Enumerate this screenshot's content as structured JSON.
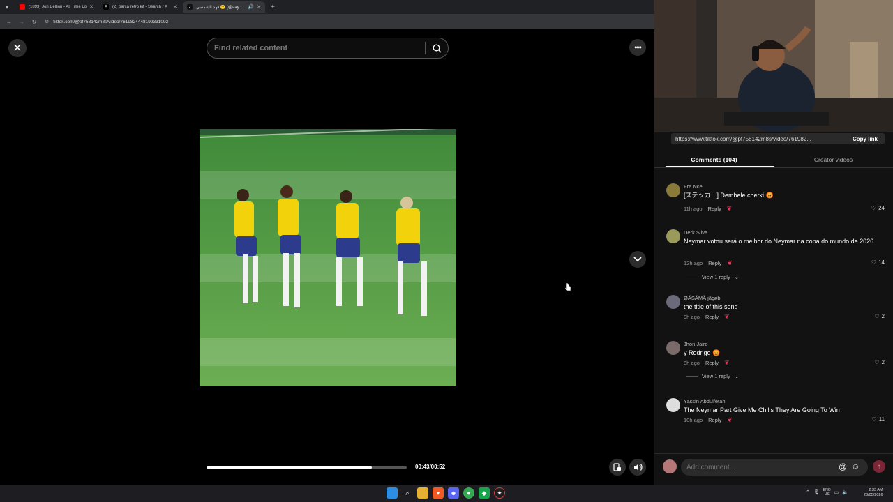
{
  "browser": {
    "tabs": [
      {
        "label": "(1893) Jon Bellion - All Time Lo",
        "favicon_color": "#ff0000",
        "active": false
      },
      {
        "label": "(2) barca retro kit - Search / X",
        "favicon_color": "#000000",
        "active": false
      },
      {
        "label": "فهد الشمسي 🙂 (@aaywasa)",
        "favicon_color": "#111111",
        "active": true
      }
    ],
    "url": "tiktok.com/@pf758142m8s/video/7619824448199331092"
  },
  "player": {
    "search_placeholder": "Find related content",
    "time": "00:43/00:52",
    "progress": 0.827
  },
  "side": {
    "share_url": "https://www.tiktok.com/@pf758142m8s/video/761982...",
    "copy_link": "Copy link",
    "tabs": [
      "Comments (104)",
      "Creator videos"
    ],
    "comments": [
      {
        "name": "Fra Nce",
        "text": "[ステッカー] Dembele cherki 😡",
        "age": "11h ago",
        "reply": "Reply",
        "likes": "24",
        "avatar_color": "#8a7a3a",
        "view_replies": ""
      },
      {
        "name": "Derk Silva",
        "text": "Neymar votou será o melhor do Neymar na copa do mundo de 2026",
        "age": "12h ago",
        "reply": "Reply",
        "likes": "14",
        "avatar_color": "#9a9a5a",
        "view_replies": "View 1 reply"
      },
      {
        "name": "ØÃSÃMÃ jãçøb",
        "text": "the title of this song",
        "age": "9h ago",
        "reply": "Reply",
        "likes": "2",
        "avatar_color": "#6a6a7a",
        "view_replies": ""
      },
      {
        "name": "Jhon Jairo",
        "text": "y Rodrigo 😡",
        "age": "8h ago",
        "reply": "Reply",
        "likes": "2",
        "avatar_color": "#7a6a6a",
        "view_replies": "View 1 reply"
      },
      {
        "name": "Yassin Abdulfetah",
        "text": "The Neymar Part Give Me Chills They Are Going To Win",
        "age": "10h ago",
        "reply": "Reply",
        "likes": "11",
        "avatar_color": "#dddddd",
        "view_replies": ""
      }
    ],
    "add_comment_placeholder": "Add comment..."
  },
  "taskbar": {
    "lang_line1": "ENG",
    "lang_line2": "US",
    "time": "2:33 AM",
    "date": "23/05/2026"
  }
}
